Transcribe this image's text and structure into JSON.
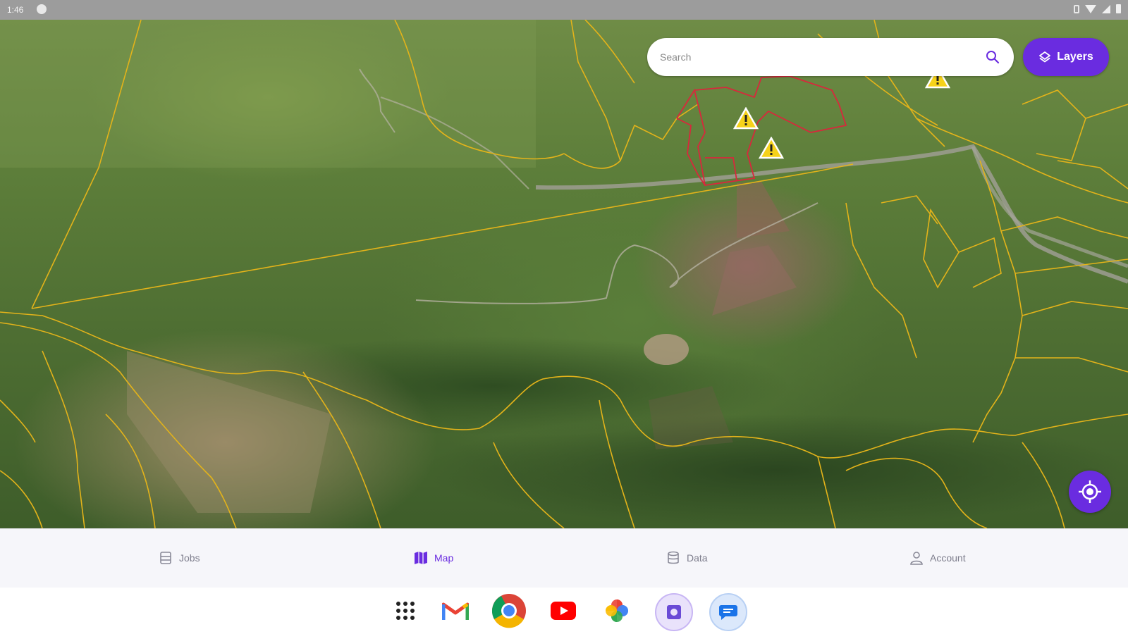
{
  "status_bar": {
    "time": "1:46",
    "icons": [
      "app-notification-icon",
      "vibrate-icon",
      "wifi-icon",
      "signal-icon",
      "battery-icon"
    ]
  },
  "map": {
    "search": {
      "placeholder": "Search"
    },
    "layers_button": {
      "label": "Layers",
      "icon": "layers-icon"
    },
    "locate_button": {
      "icon": "my-location-icon"
    },
    "markers": [
      {
        "type": "warning",
        "icon": "warning-triangle-icon"
      },
      {
        "type": "warning",
        "icon": "warning-triangle-icon"
      },
      {
        "type": "warning",
        "icon": "warning-triangle-icon"
      }
    ],
    "colors": {
      "parcel_boundary": "#e3b31a",
      "selected_parcel": "#d8283c",
      "accent": "#6a2ce0"
    }
  },
  "bottom_nav": {
    "items": [
      {
        "label": "Jobs",
        "icon": "jobs-icon",
        "active": false
      },
      {
        "label": "Map",
        "icon": "map-icon",
        "active": true
      },
      {
        "label": "Data",
        "icon": "database-icon",
        "active": false
      },
      {
        "label": "Account",
        "icon": "account-icon",
        "active": false
      }
    ]
  },
  "dock": {
    "apps": [
      "app-drawer-icon",
      "gmail-icon",
      "chrome-icon",
      "youtube-icon",
      "photos-icon",
      "screen-recorder-icon",
      "messages-icon"
    ]
  }
}
